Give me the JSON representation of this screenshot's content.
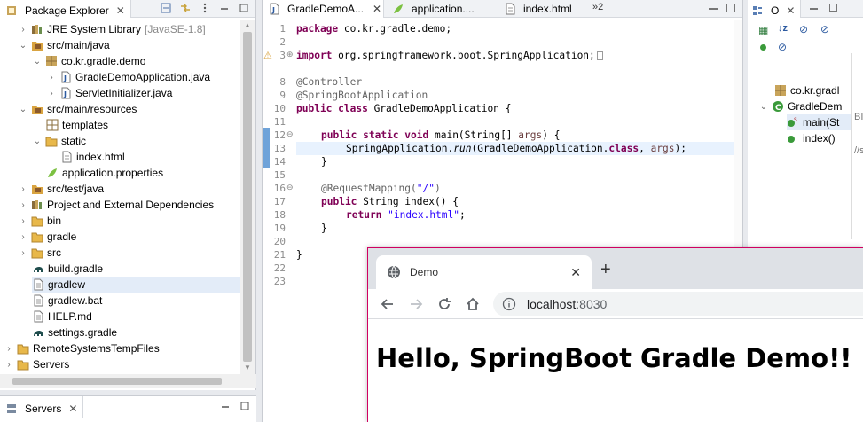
{
  "package_explorer": {
    "title": "Package Explorer",
    "tree": [
      {
        "label": "JRE System Library",
        "decoration": "[JavaSE-1.8]",
        "icon": "library-icon"
      },
      {
        "label": "src/main/java",
        "icon": "source-folder-icon"
      },
      {
        "label": "co.kr.gradle.demo",
        "icon": "package-icon"
      },
      {
        "label": "GradleDemoApplication.java",
        "icon": "java-file-icon"
      },
      {
        "label": "ServletInitializer.java",
        "icon": "java-file-icon"
      },
      {
        "label": "src/main/resources",
        "icon": "source-folder-icon"
      },
      {
        "label": "templates",
        "icon": "package-icon"
      },
      {
        "label": "static",
        "icon": "folder-icon"
      },
      {
        "label": "index.html",
        "icon": "html-file-icon"
      },
      {
        "label": "application.properties",
        "icon": "properties-file-icon"
      },
      {
        "label": "src/test/java",
        "icon": "source-folder-icon"
      },
      {
        "label": "Project and External Dependencies",
        "icon": "library-icon"
      },
      {
        "label": "bin",
        "icon": "folder-icon"
      },
      {
        "label": "gradle",
        "icon": "folder-icon"
      },
      {
        "label": "src",
        "icon": "folder-icon"
      },
      {
        "label": "build.gradle",
        "icon": "gradle-file-icon"
      },
      {
        "label": "gradlew",
        "icon": "text-file-icon"
      },
      {
        "label": "gradlew.bat",
        "icon": "text-file-icon"
      },
      {
        "label": "HELP.md",
        "icon": "text-file-icon"
      },
      {
        "label": "settings.gradle",
        "icon": "gradle-file-icon"
      },
      {
        "label": "RemoteSystemsTempFiles",
        "icon": "project-icon"
      },
      {
        "label": "Servers",
        "icon": "project-icon"
      }
    ]
  },
  "servers_view": {
    "title": "Servers"
  },
  "editor": {
    "tabs": [
      {
        "label": "GradleDemoA..."
      },
      {
        "label": "application...."
      },
      {
        "label": "index.html"
      }
    ],
    "overflow": "»2",
    "line_numbers": [
      "1",
      "2",
      "3",
      "8",
      "9",
      "10",
      "11",
      "12",
      "13",
      "14",
      "15",
      "16",
      "17",
      "18",
      "19",
      "20",
      "21",
      "22",
      "23"
    ],
    "code": {
      "l1_kw": "package",
      "l1_rest": " co.kr.gradle.demo;",
      "l3_kw": "import",
      "l3_rest": " org.springframework.boot.SpringApplication;",
      "l8": "",
      "l9": "@Controller",
      "l10": "@SpringBootApplication",
      "l11_kw": "public class",
      "l11_rest": " GradleDemoApplication {",
      "l13_kw1": "public static void",
      "l13_rest": " main(String[] ",
      "l13_param": "args",
      "l13_end": ") {",
      "l14_a": "SpringApplication.",
      "l14_run": "run",
      "l14_b": "(GradleDemoApplication.",
      "l14_kw": "class",
      "l14_c": ", ",
      "l14_param": "args",
      "l14_d": ");",
      "l15": "}",
      "l17_an": "@RequestMapping(",
      "l17_str": "\"/\"",
      "l17_end": ")",
      "l18_kw": "public",
      "l18_rest": " String index() {",
      "l19_kw": "return",
      "l19_str": "\"index.html\"",
      "l19_end": ";",
      "l20": "}",
      "l22": "}"
    }
  },
  "outline": {
    "title": "O",
    "items": [
      {
        "label": "co.kr.gradl"
      },
      {
        "label": "GradleDem"
      },
      {
        "label": "main(St"
      },
      {
        "label": "index()"
      }
    ],
    "side_text": [
      "ВІТ",
      "//s"
    ]
  },
  "browser": {
    "tab_title": "Demo",
    "url_host": "localhost",
    "url_port": ":8030",
    "heading": "Hello, SpringBoot Gradle Demo!!"
  },
  "colors": {
    "keyword": "#7f0055",
    "string": "#2a00ff",
    "annotation": "#646464",
    "browser_border": "#d00060"
  }
}
